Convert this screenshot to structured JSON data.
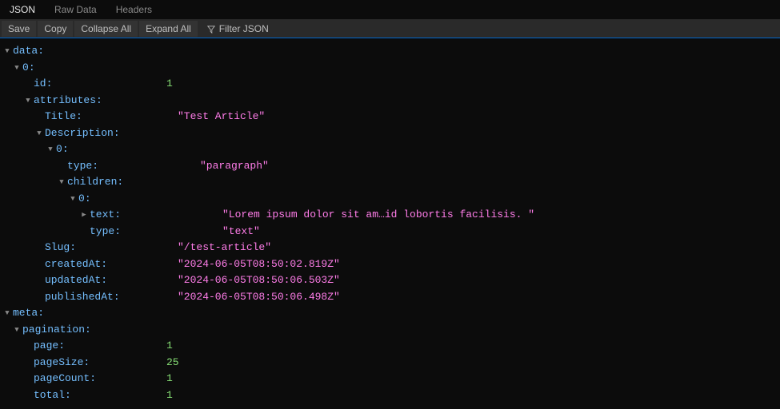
{
  "tabs": {
    "json": "JSON",
    "raw": "Raw Data",
    "headers": "Headers"
  },
  "toolbar": {
    "save": "Save",
    "copy": "Copy",
    "collapseAll": "Collapse All",
    "expandAll": "Expand All",
    "filter": "Filter JSON"
  },
  "keys": {
    "data": "data",
    "zero": "0",
    "id": "id",
    "attributes": "attributes",
    "title": "Title",
    "description": "Description",
    "type": "type",
    "children": "children",
    "text": "text",
    "slug": "Slug",
    "createdAt": "createdAt",
    "updatedAt": "updatedAt",
    "publishedAt": "publishedAt",
    "meta": "meta",
    "pagination": "pagination",
    "page": "page",
    "pageSize": "pageSize",
    "pageCount": "pageCount",
    "total": "total"
  },
  "values": {
    "id": "1",
    "title": "\"Test Article\"",
    "descType": "\"paragraph\"",
    "childText": "\"Lorem ipsum dolor sit am…id lobortis facilisis. \"",
    "childType": "\"text\"",
    "slug": "\"/test-article\"",
    "createdAt": "\"2024-06-05T08:50:02.819Z\"",
    "updatedAt": "\"2024-06-05T08:50:06.503Z\"",
    "publishedAt": "\"2024-06-05T08:50:06.498Z\"",
    "page": "1",
    "pageSize": "25",
    "pageCount": "1",
    "total": "1"
  },
  "colon": ":"
}
